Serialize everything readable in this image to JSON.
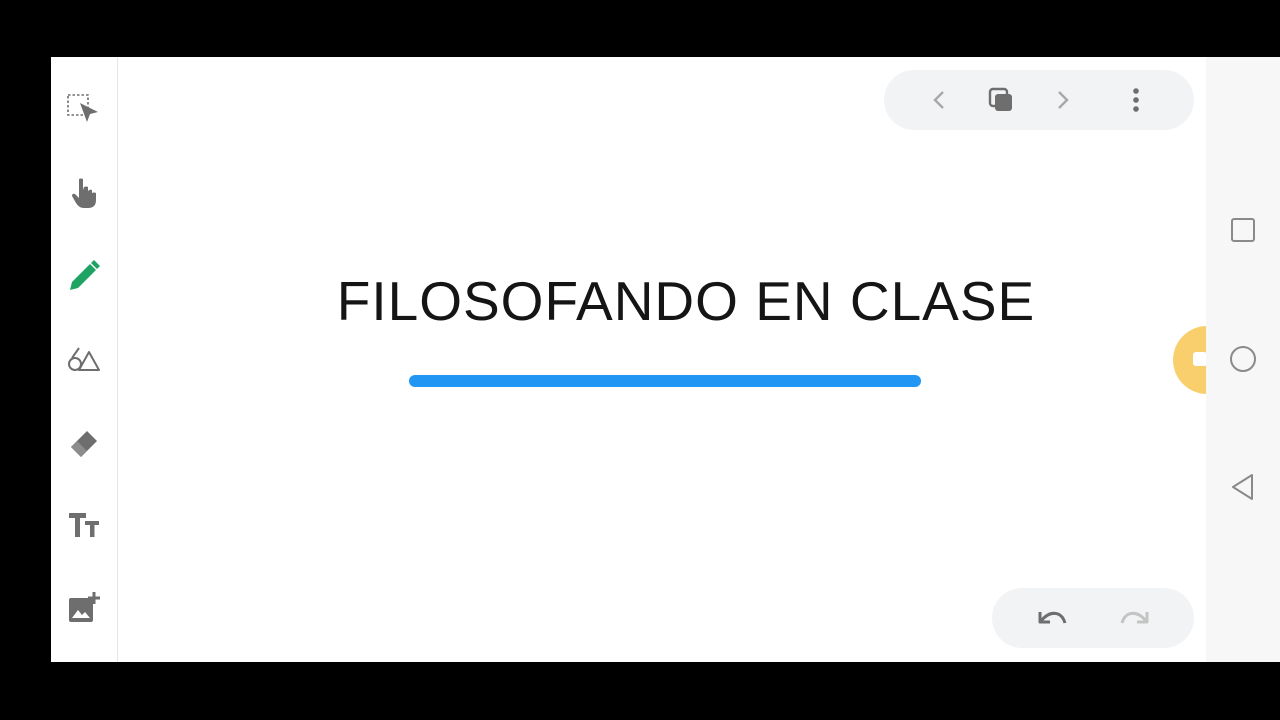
{
  "canvas": {
    "title": "FILOSOFANDO EN CLASE",
    "underline_color": "#2196f3"
  },
  "toolbar": {
    "tools": [
      {
        "icon": "selection-icon",
        "active": false
      },
      {
        "icon": "hand-icon",
        "active": false
      },
      {
        "icon": "pen-icon",
        "active": true,
        "color": "#1ea362"
      },
      {
        "icon": "shapes-icon",
        "active": false
      },
      {
        "icon": "eraser-icon",
        "active": false
      },
      {
        "icon": "text-icon",
        "active": false
      },
      {
        "icon": "add-image-icon",
        "active": false
      }
    ]
  },
  "page_nav": {
    "icons": [
      "chevron-left-icon",
      "pages-icon",
      "chevron-right-icon",
      "more-vertical-icon"
    ]
  },
  "history": {
    "icons": [
      "undo-icon",
      "redo-icon"
    ],
    "redo_enabled": false
  },
  "system_nav": {
    "icons": [
      "recents-square-icon",
      "home-circle-icon",
      "back-triangle-icon"
    ]
  },
  "floating_widget": {
    "icon": "screen-recorder-icon",
    "color": "#f9cf6d"
  }
}
